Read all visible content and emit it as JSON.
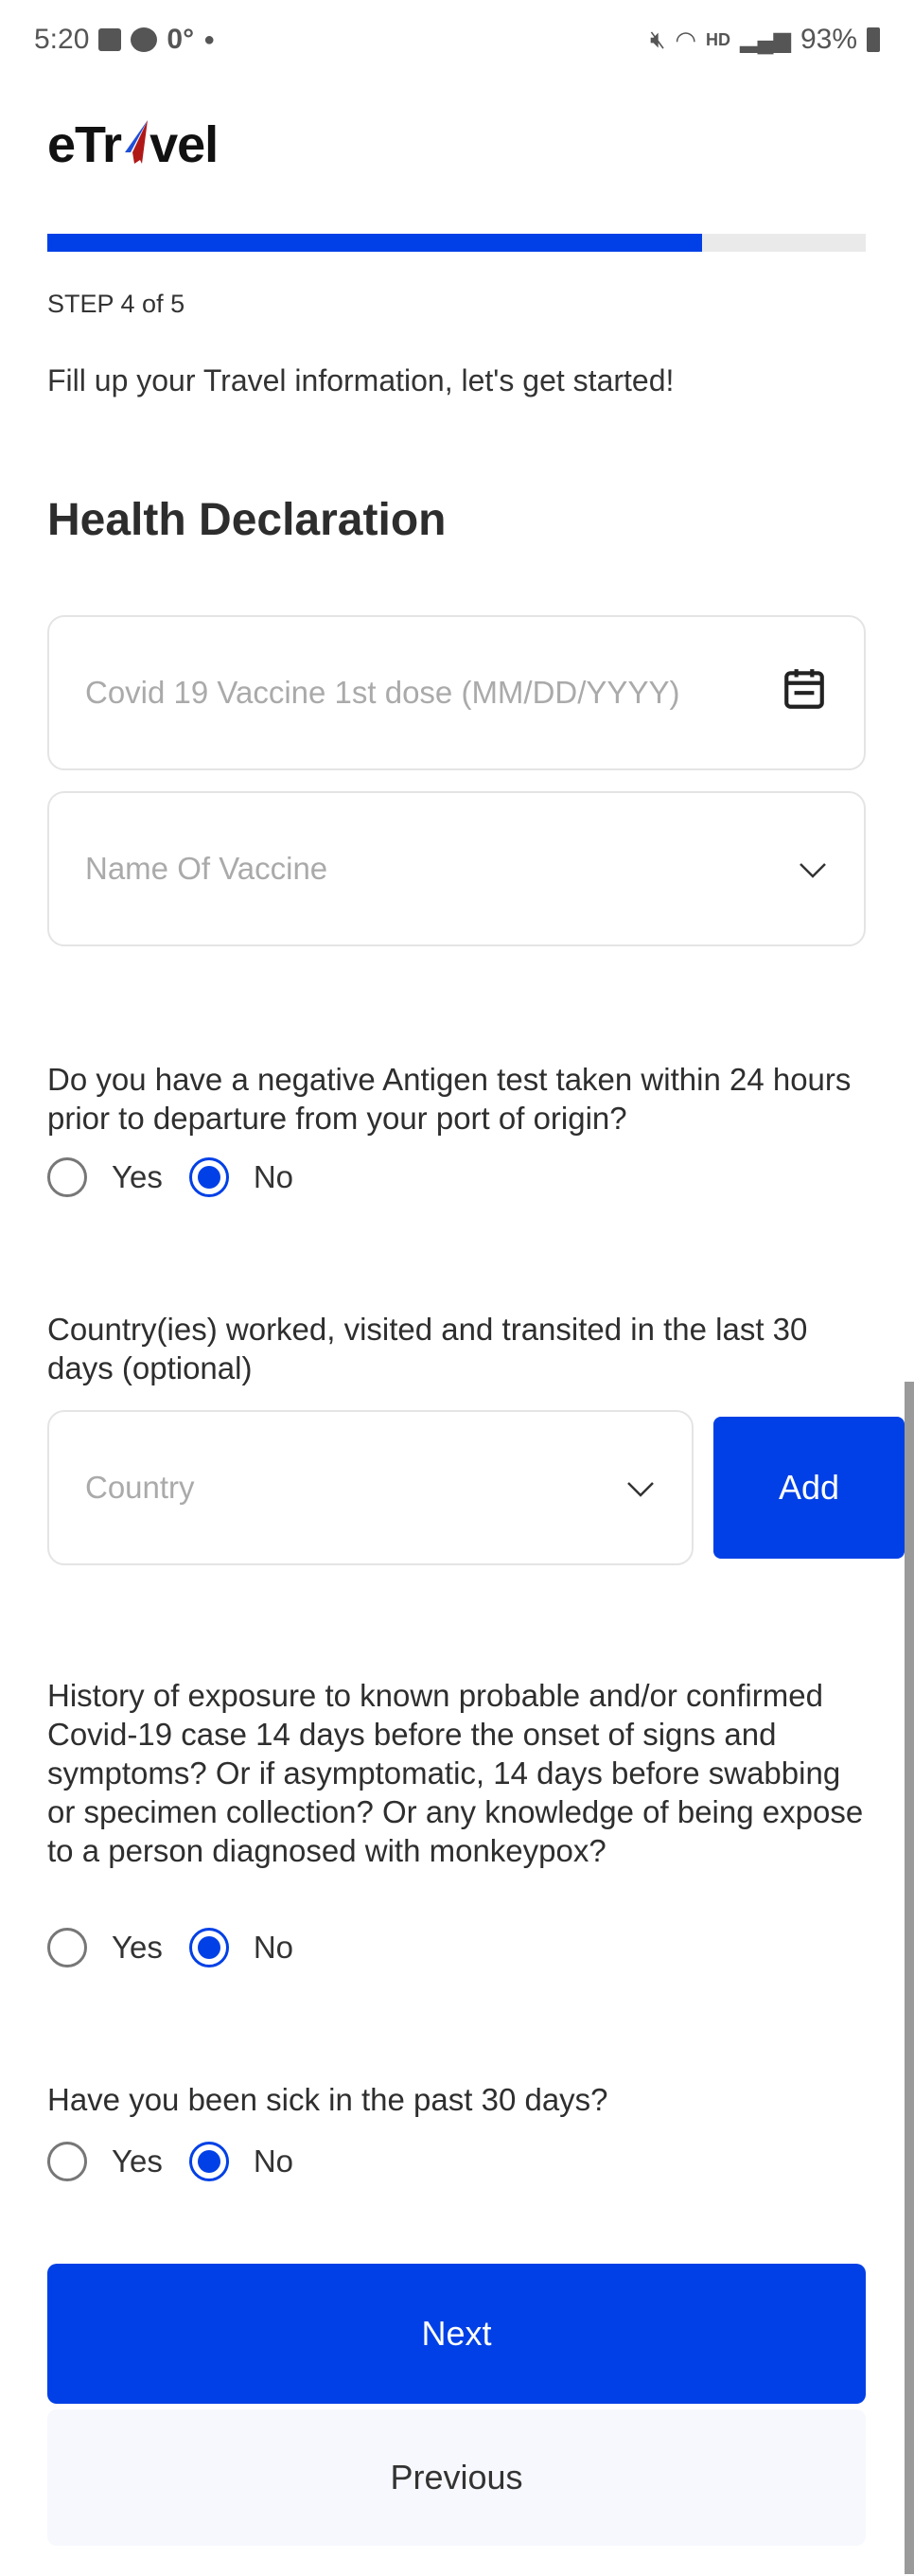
{
  "status_bar": {
    "time": "5:20",
    "temp": "0°",
    "battery": "93%",
    "hd": "HD"
  },
  "app": {
    "logo": "eTravel"
  },
  "progress": {
    "step_label": "STEP 4 of 5",
    "percent": 80,
    "accent": "#0040e6"
  },
  "intro": "Fill up your Travel information, let's get started!",
  "section_title": "Health Declaration",
  "fields": {
    "vaccine_date": {
      "placeholder": "Covid 19 Vaccine 1st dose (MM/DD/YYYY)",
      "icon": "calendar-icon"
    },
    "vaccine_name": {
      "placeholder": "Name Of Vaccine",
      "icon": "chevron-down-icon"
    },
    "country": {
      "placeholder": "Country",
      "icon": "chevron-down-icon"
    }
  },
  "questions": [
    {
      "text": "Do you have a negative Antigen test taken within 24 hours prior to departure from your port of origin?",
      "options": [
        "Yes",
        "No"
      ],
      "selected": "No"
    },
    {
      "text": "Country(ies) worked, visited and transited in the last 30 days (optional)"
    },
    {
      "text": "History of exposure to known probable and/or confirmed Covid-19 case 14 days before the onset of signs and symptoms? Or if asymptomatic, 14 days before swabbing or specimen collection? Or any knowledge of being expose to a person diagnosed with monkeypox?",
      "options": [
        "Yes",
        "No"
      ],
      "selected": "No"
    },
    {
      "text": "Have you been sick in the past 30 days?",
      "options": [
        "Yes",
        "No"
      ],
      "selected": "No"
    }
  ],
  "buttons": {
    "add": "Add",
    "next": "Next",
    "previous": "Previous"
  }
}
